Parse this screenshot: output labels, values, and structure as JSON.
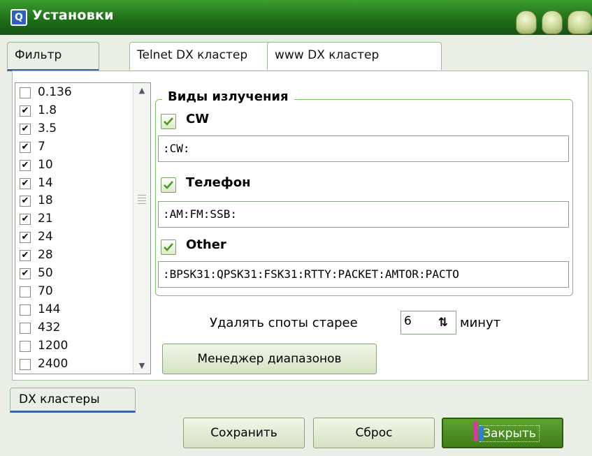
{
  "window": {
    "title": "Установки",
    "icon": "app-icon"
  },
  "tabs": [
    "Фильтр",
    "Telnet DX кластер",
    "www DX кластер"
  ],
  "active_tab": 0,
  "bands": [
    {
      "label": "0.136",
      "checked": false
    },
    {
      "label": "1.8",
      "checked": true
    },
    {
      "label": "3.5",
      "checked": true
    },
    {
      "label": "7",
      "checked": true
    },
    {
      "label": "10",
      "checked": true
    },
    {
      "label": "14",
      "checked": true
    },
    {
      "label": "18",
      "checked": true
    },
    {
      "label": "21",
      "checked": true
    },
    {
      "label": "24",
      "checked": true
    },
    {
      "label": "28",
      "checked": true
    },
    {
      "label": "50",
      "checked": true
    },
    {
      "label": "70",
      "checked": false
    },
    {
      "label": "144",
      "checked": false
    },
    {
      "label": "432",
      "checked": false
    },
    {
      "label": "1200",
      "checked": false
    },
    {
      "label": "2400",
      "checked": false
    }
  ],
  "modes": {
    "group_title": "Виды излучения",
    "cw": {
      "label": "CW",
      "checked": true,
      "value": ":CW:"
    },
    "phone": {
      "label": "Телефон",
      "checked": true,
      "value": ":AM:FM:SSB:"
    },
    "other": {
      "label": "Other",
      "checked": true,
      "value": ":BPSK31:QPSK31:FSK31:RTTY:PACKET:AMTOR:PACTO"
    }
  },
  "spot_age": {
    "prefix": "Удалять споты старее",
    "value": "6",
    "suffix": "минут"
  },
  "band_manager_label": "Менеджер диапазонов",
  "bottom_tab": "DX кластеры",
  "buttons": {
    "save": "Сохранить",
    "reset": "Сброс",
    "close": "Закрыть"
  },
  "colors": {
    "titlebar": "#1e6b17",
    "accent_tab": "#3d63a6",
    "check_green": "#4a9a1e"
  }
}
